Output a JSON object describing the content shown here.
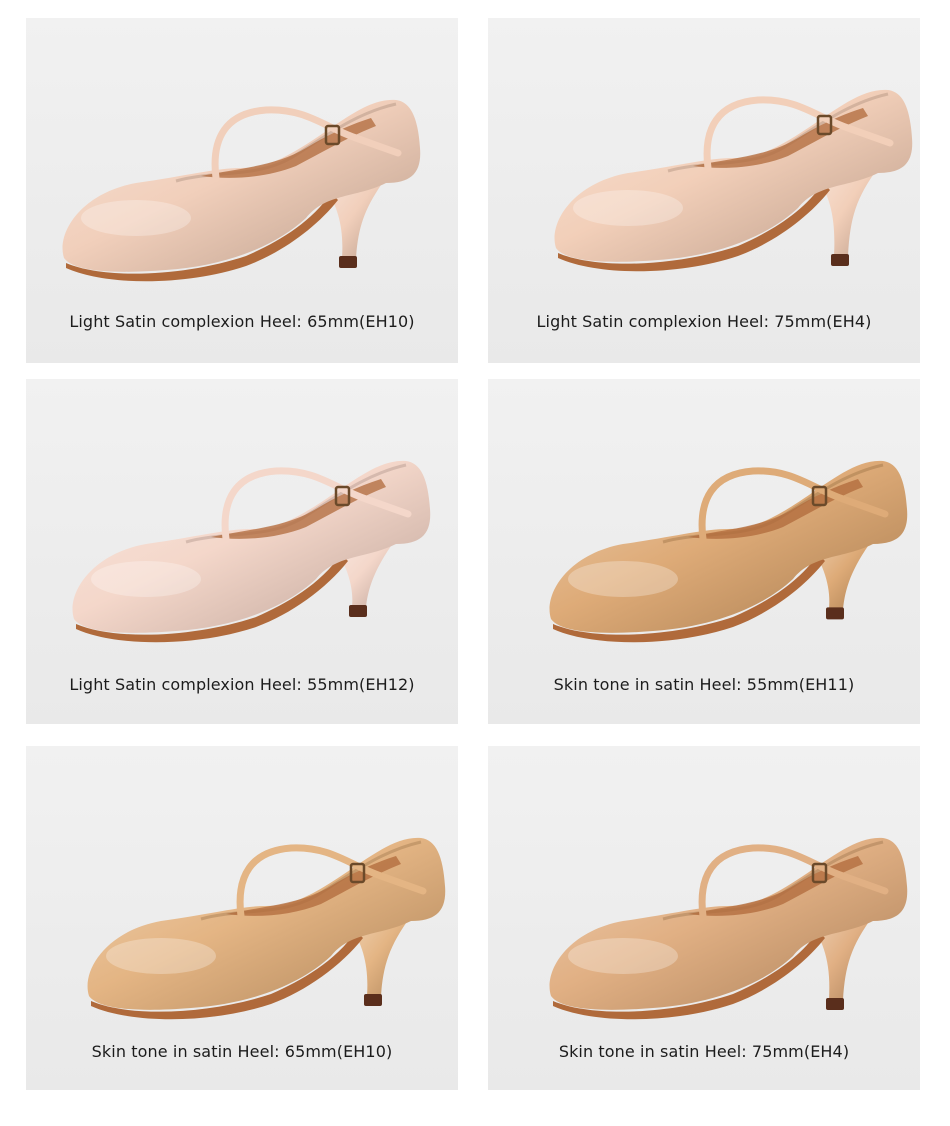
{
  "products": [
    {
      "caption": "Light Satin complexion Heel: 65mm(EH10)",
      "color": "#efc9b2"
    },
    {
      "caption": "Light Satin complexion Heel: 75mm(EH4)",
      "color": "#f0c8b0"
    },
    {
      "caption": "Light Satin complexion Heel: 55mm(EH12)",
      "color": "#f2d1c3"
    },
    {
      "caption": "Skin tone in satin Heel: 55mm(EH11)",
      "color": "#d9a066"
    },
    {
      "caption": "Skin tone in satin Heel: 65mm(EH10)",
      "color": "#e0ab73"
    },
    {
      "caption": "Skin tone in satin Heel: 75mm(EH4)",
      "color": "#dda573"
    }
  ],
  "sole_color": "#b06a3b",
  "heel_tip_color": "#5a2e1c"
}
